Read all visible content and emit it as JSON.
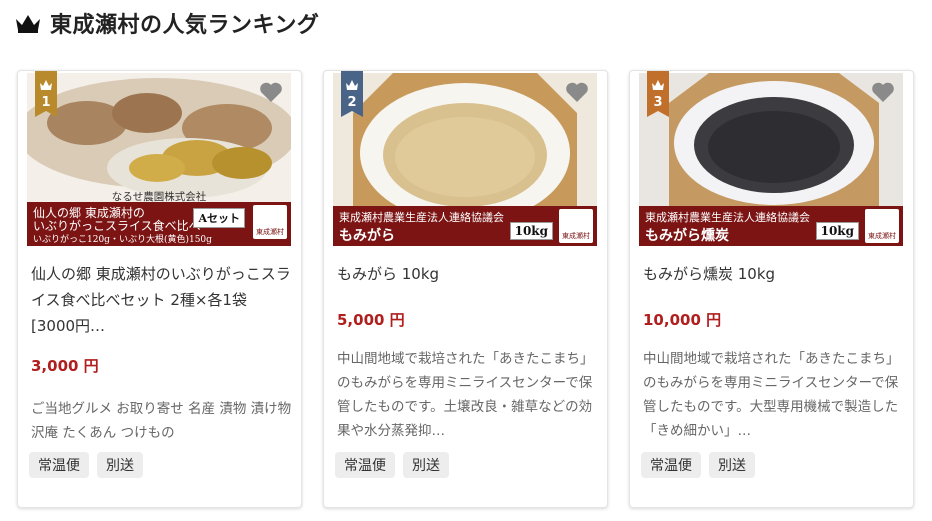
{
  "header": {
    "title": "東成瀬村の人気ランキング"
  },
  "colors": {
    "accent_price": "#b01e1e",
    "band": "#7c1414",
    "rank1": "#b88a2b",
    "rank2": "#4a6488",
    "rank3": "#c0702a"
  },
  "products": [
    {
      "rank": "1",
      "image_text": {
        "top": "なるせ農園株式会社",
        "line1": "仙人の郷 東成瀬村の",
        "line2": "いぶりがっこスライス食べ比べ",
        "line3": "いぶりがっこ120g・いぶり大根(黄色)150g",
        "tag": "Aセット",
        "logo": "東成瀬村"
      },
      "name": "仙人の郷 東成瀬村のいぶりがっこスライス食べ比べセット 2種×各1袋 [3000円…",
      "price": "3,000 円",
      "description": "ご当地グルメ お取り寄せ 名産 漬物 漬け物 沢庵 たくあん つけもの",
      "tags": [
        "常温便",
        "別送"
      ]
    },
    {
      "rank": "2",
      "image_text": {
        "line1": "東成瀬村農業生産法人連絡協議会",
        "line2": "もみがら",
        "tag": "10kg",
        "logo": "東成瀬村"
      },
      "name": "もみがら 10kg",
      "price": "5,000 円",
      "description": "中山間地域で栽培された「あきたこまち」のもみがらを専用ミニライスセンターで保管したものです。土壌改良・雑草などの効果や水分蒸発抑…",
      "tags": [
        "常温便",
        "別送"
      ]
    },
    {
      "rank": "3",
      "image_text": {
        "line1": "東成瀬村農業生産法人連絡協議会",
        "line2": "もみがら燻炭",
        "tag": "10kg",
        "logo": "東成瀬村"
      },
      "name": "もみがら燻炭 10kg",
      "price": "10,000 円",
      "description": "中山間地域で栽培された「あきたこまち」のもみがらを専用ミニライスセンターで保管したものです。大型専用機械で製造した「きめ細かい」…",
      "tags": [
        "常温便",
        "別送"
      ]
    }
  ]
}
